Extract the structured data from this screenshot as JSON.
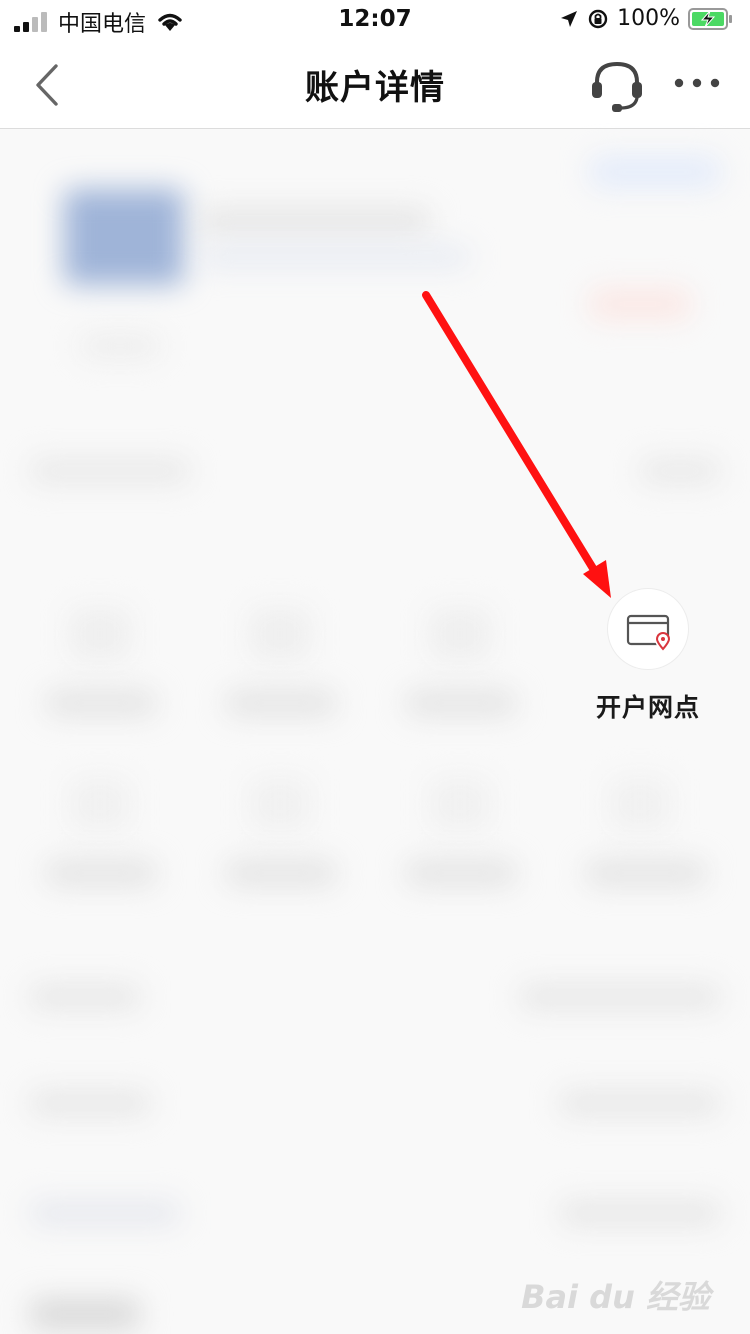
{
  "status_bar": {
    "carrier": "中国电信",
    "time": "12:07",
    "battery": "100%"
  },
  "nav": {
    "title": "账户详情",
    "back_icon": "chevron-left-icon",
    "service_icon": "headset-icon",
    "more_icon": "more-dots-icon"
  },
  "branch": {
    "label": "开户网点",
    "icon": "bank-card-location-icon"
  },
  "colors": {
    "annotation_arrow": "#ff1111",
    "pin_red": "#d9363e"
  }
}
